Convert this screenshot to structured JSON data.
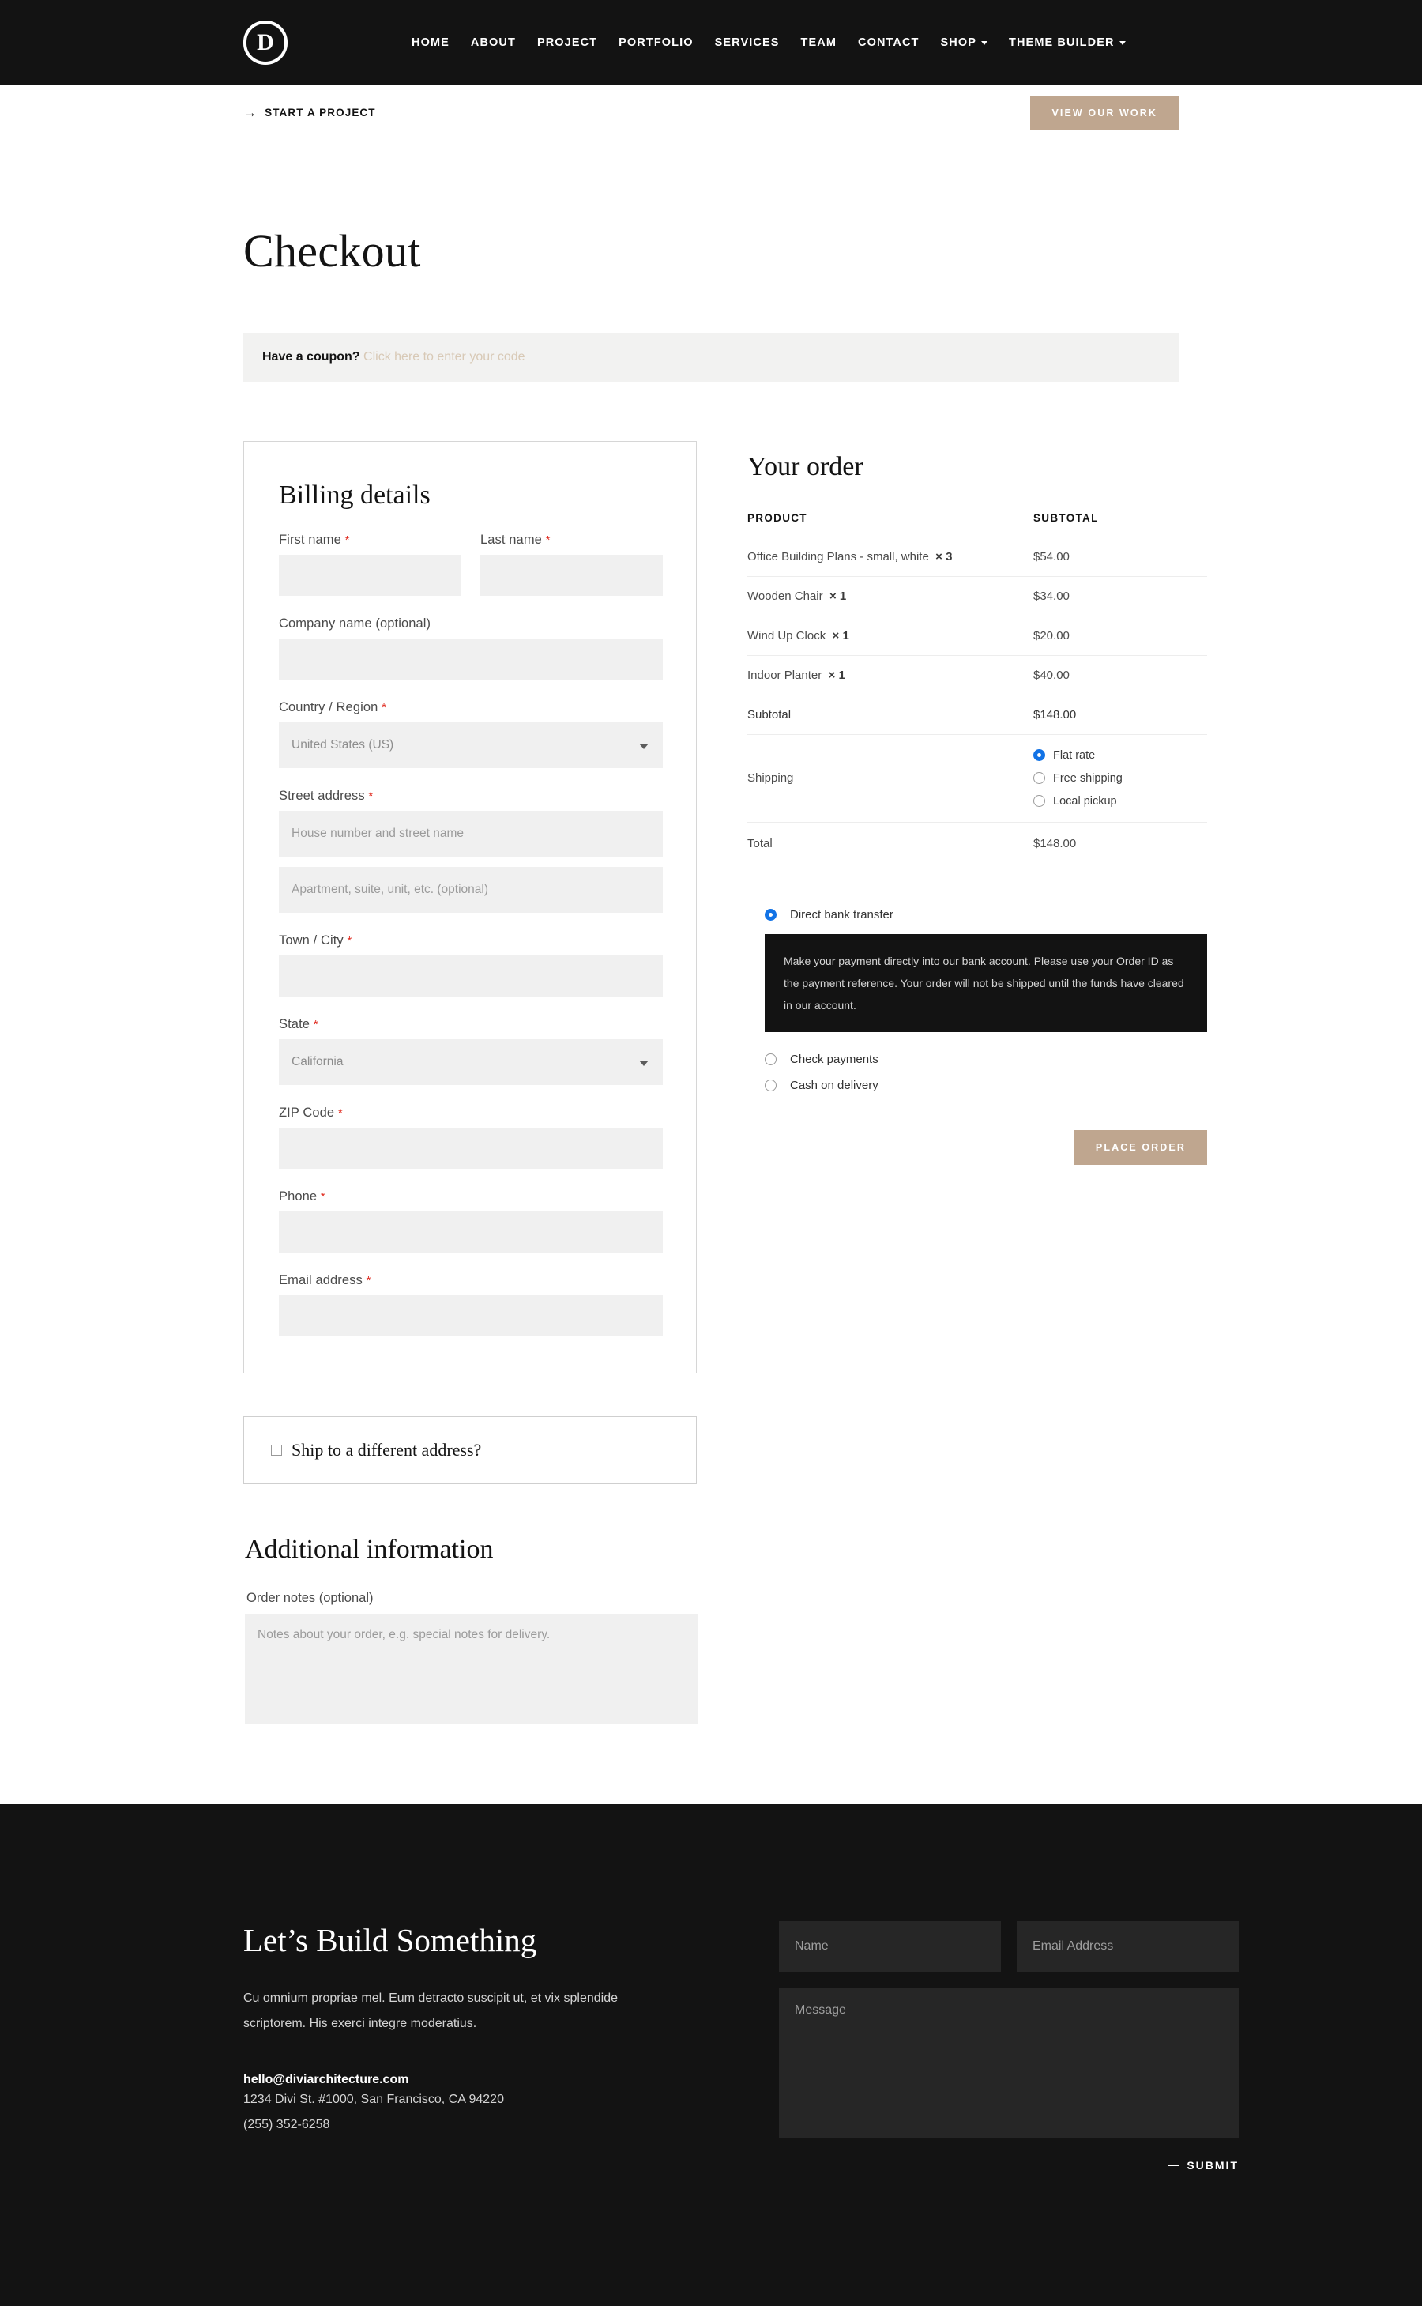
{
  "theme": {
    "accent_tan": "#bfa68f",
    "dark": "#131313",
    "field_gray": "#f0f0f0",
    "required_red": "#e02b20",
    "radio_blue": "#1273e6"
  },
  "nav": {
    "logo_letter": "D",
    "items": [
      {
        "label": "HOME",
        "has_submenu": false
      },
      {
        "label": "ABOUT",
        "has_submenu": false
      },
      {
        "label": "PROJECT",
        "has_submenu": false
      },
      {
        "label": "PORTFOLIO",
        "has_submenu": false
      },
      {
        "label": "SERVICES",
        "has_submenu": false
      },
      {
        "label": "TEAM",
        "has_submenu": false
      },
      {
        "label": "CONTACT",
        "has_submenu": false
      },
      {
        "label": "SHOP",
        "has_submenu": true
      },
      {
        "label": "THEME BUILDER",
        "has_submenu": true
      }
    ]
  },
  "subheader": {
    "start_project": "START A PROJECT",
    "cta_button": "VIEW OUR WORK"
  },
  "page": {
    "title": "Checkout"
  },
  "coupon": {
    "question": "Have a coupon?",
    "link": "Click here to enter your code"
  },
  "billing": {
    "heading": "Billing details",
    "first_name": {
      "label": "First name",
      "required": true,
      "value": "",
      "placeholder": ""
    },
    "last_name": {
      "label": "Last name",
      "required": true,
      "value": "",
      "placeholder": ""
    },
    "company": {
      "label": "Company name (optional)",
      "required": false,
      "value": "",
      "placeholder": ""
    },
    "country": {
      "label": "Country / Region",
      "required": true,
      "value": "United States (US)"
    },
    "street": {
      "label": "Street address",
      "required": true,
      "line1_placeholder": "House number and street name",
      "line2_placeholder": "Apartment, suite, unit, etc. (optional)",
      "line1_value": "",
      "line2_value": ""
    },
    "city": {
      "label": "Town / City",
      "required": true,
      "value": "",
      "placeholder": ""
    },
    "state": {
      "label": "State",
      "required": true,
      "value": "California"
    },
    "zip": {
      "label": "ZIP Code",
      "required": true,
      "value": "",
      "placeholder": ""
    },
    "phone": {
      "label": "Phone",
      "required": true,
      "value": "",
      "placeholder": ""
    },
    "email": {
      "label": "Email address",
      "required": true,
      "value": "",
      "placeholder": ""
    }
  },
  "ship_different": {
    "label": "Ship to a different address?",
    "checked": false
  },
  "additional": {
    "heading": "Additional information",
    "notes_label": "Order notes (optional)",
    "notes_placeholder": "Notes about your order, e.g. special notes for delivery.",
    "notes_value": ""
  },
  "order": {
    "heading": "Your order",
    "columns": {
      "product": "PRODUCT",
      "subtotal": "SUBTOTAL"
    },
    "items": [
      {
        "name": "Office Building Plans - small, white",
        "qty": "× 3",
        "amount": "$54.00"
      },
      {
        "name": "Wooden Chair",
        "qty": "× 1",
        "amount": "$34.00"
      },
      {
        "name": "Wind Up Clock",
        "qty": "× 1",
        "amount": "$20.00"
      },
      {
        "name": "Indoor Planter",
        "qty": "× 1",
        "amount": "$40.00"
      }
    ],
    "subtotal": {
      "label": "Subtotal",
      "amount": "$148.00"
    },
    "shipping": {
      "label": "Shipping",
      "options": [
        {
          "label": "Flat rate",
          "selected": true
        },
        {
          "label": "Free shipping",
          "selected": false
        },
        {
          "label": "Local pickup",
          "selected": false
        }
      ]
    },
    "total": {
      "label": "Total",
      "amount": "$148.00"
    }
  },
  "payment": {
    "methods": [
      {
        "label": "Direct bank transfer",
        "selected": true
      },
      {
        "label": "Check payments",
        "selected": false
      },
      {
        "label": "Cash on delivery",
        "selected": false
      }
    ],
    "note": "Make your payment directly into our bank account. Please use your Order ID as the payment reference. Your order will not be shipped until the funds have cleared in our account.",
    "place_order_button": "PLACE ORDER"
  },
  "footer": {
    "title": "Let’s Build Something",
    "paragraph": "Cu omnium propriae mel. Eum detracto suscipit ut, et vix splendide scriptorem. His exerci integre moderatius.",
    "email": "hello@diviarchitecture.com",
    "address": "1234 Divi St. #1000, San Francisco, CA 94220",
    "phone": "(255) 352-6258",
    "form": {
      "name_placeholder": "Name",
      "email_placeholder": "Email Address",
      "message_placeholder": "Message",
      "name_value": "",
      "email_value": "",
      "message_value": "",
      "submit_label": "SUBMIT"
    }
  }
}
